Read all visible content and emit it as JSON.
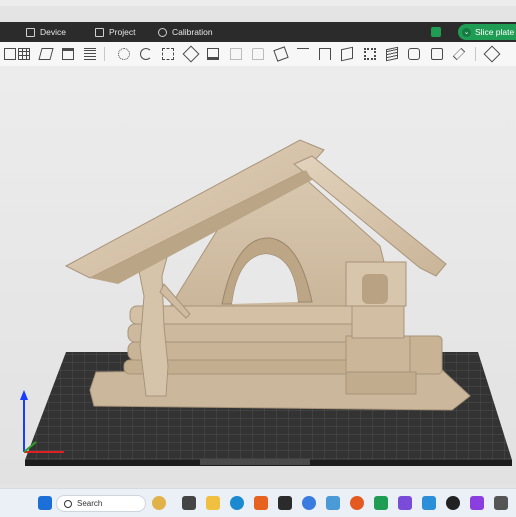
{
  "menubar": {
    "device_label": "Device",
    "project_label": "Project",
    "calibration_label": "Calibration",
    "slice_button_label": "Slice plate"
  },
  "toolbar": {
    "buttons": [
      "add",
      "arrange-grid",
      "orient",
      "split",
      "layers",
      "move",
      "rotate",
      "scale",
      "cut",
      "support",
      "seam",
      "text",
      "measure",
      "assembly",
      "boolean",
      "variable-layer",
      "zoom-fit",
      "slice-view",
      "color-paint",
      "brim-ears",
      "settings"
    ]
  },
  "viewport": {
    "model": "house",
    "bed_label": "",
    "axis_colors": {
      "z": "#1a3cff",
      "x": "#e02020",
      "y": "#2aa02a"
    }
  },
  "taskbar": {
    "search_placeholder": "Search"
  },
  "colors": {
    "accent": "#1f9d55",
    "menubar_bg": "#2b2b2b",
    "model_color": "#d7c5ac",
    "bed_color": "#303030"
  }
}
